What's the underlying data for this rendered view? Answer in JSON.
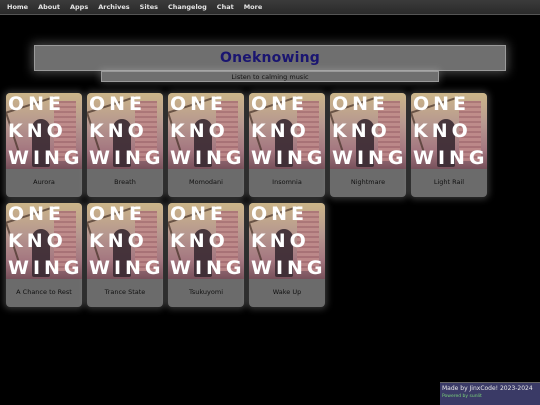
{
  "nav": {
    "items": [
      {
        "label": "Home"
      },
      {
        "label": "About"
      },
      {
        "label": "Apps"
      },
      {
        "label": "Archives"
      },
      {
        "label": "Sites"
      },
      {
        "label": "Changelog"
      },
      {
        "label": "Chat"
      },
      {
        "label": "More"
      }
    ]
  },
  "header": {
    "title": "Oneknowing",
    "subtitle": "Listen to calming music"
  },
  "cover_art": {
    "lines": [
      "ONE",
      "KNO",
      "WING"
    ]
  },
  "tracks": [
    {
      "label": "Aurora"
    },
    {
      "label": "Breath"
    },
    {
      "label": "Momodani"
    },
    {
      "label": "Insomnia"
    },
    {
      "label": "Nightmare"
    },
    {
      "label": "Light Rail"
    },
    {
      "label": "A Chance to Rest"
    },
    {
      "label": "Trance State"
    },
    {
      "label": "Tsukuyomi"
    },
    {
      "label": "Wake Up"
    }
  ],
  "footer": {
    "credit": "Made by JinxCode! 2023-2024",
    "powered": "Powered by sunlit"
  },
  "colors": {
    "background": "#000000",
    "title_text": "#1a1570",
    "card": "#6b6b6b",
    "footer_bg": "#3a3a66",
    "footer_powered": "#7ad37a"
  }
}
